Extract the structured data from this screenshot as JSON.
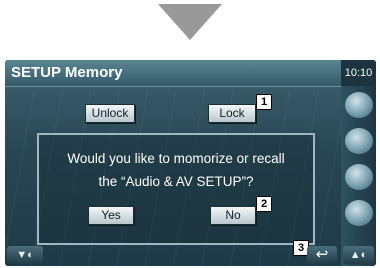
{
  "header": {
    "title": "SETUP Memory",
    "clock": "10:10"
  },
  "buttons": {
    "unlock": "Unlock",
    "lock": "Lock",
    "yes": "Yes",
    "no": "No"
  },
  "dialog": {
    "line1": "Would you like to momorize or recall",
    "line2": "the “Audio & AV SETUP”?"
  },
  "callouts": {
    "c1": "1",
    "c2": "2",
    "c3": "3"
  },
  "icons": [
    "down-arrow-icon",
    "speaker-icon",
    "back-icon",
    "settings-icon",
    "media-icon",
    "disc-icon"
  ],
  "colors": {
    "panel": "#284654",
    "header": "#4a7483",
    "arrow": "#999999"
  }
}
